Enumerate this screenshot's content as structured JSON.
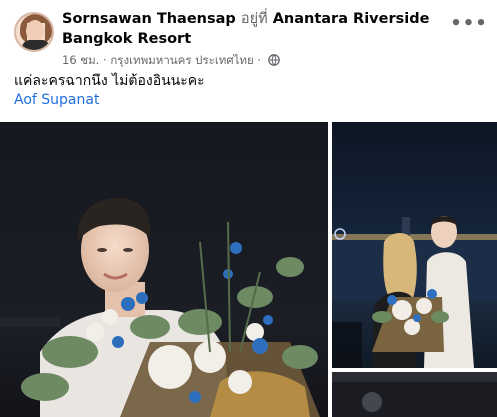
{
  "post": {
    "author": "Sornsawan Thaensap",
    "at_text": "อยู่ที่",
    "location": "Anantara Riverside Bangkok Resort",
    "time": "16 ชม.",
    "separator": "·",
    "place": "กรุงเทพมหานคร ประเทศไทย",
    "separator2": "·",
    "audience_icon": "globe-icon",
    "more_icon": "more-options-icon",
    "more_label": "•••",
    "caption": "แค่ละครฉากนึง ไม่ต้องอินนะคะ",
    "tagged_user": "Aof Supanat"
  },
  "colors": {
    "link": "#216fdb",
    "muted": "#65676b",
    "text": "#050505"
  }
}
